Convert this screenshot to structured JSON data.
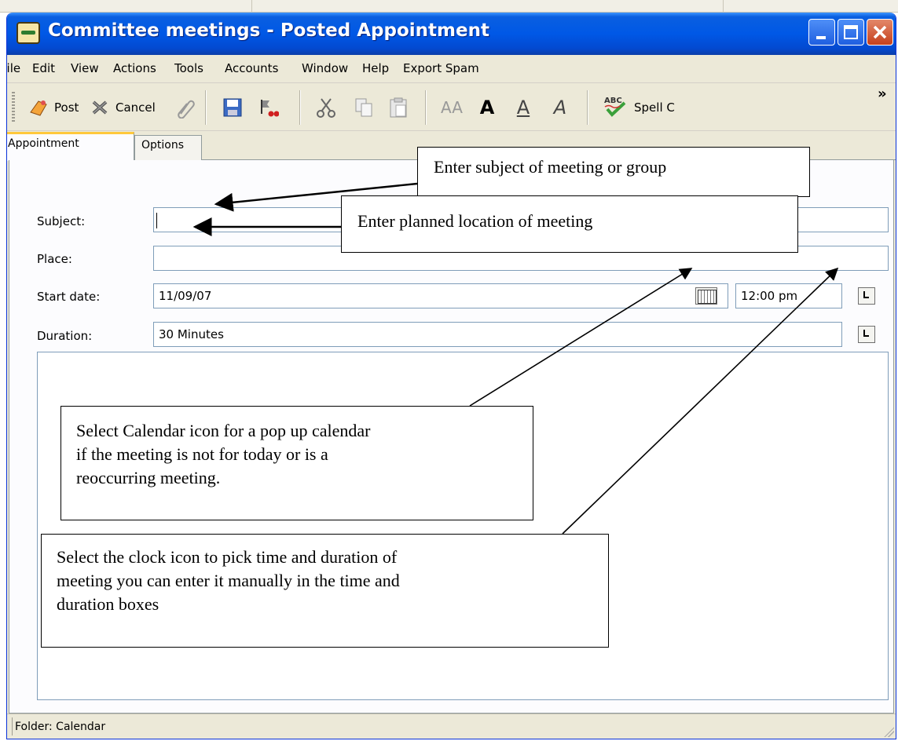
{
  "window": {
    "title": "Committee meetings - Posted Appointment"
  },
  "menu": [
    "File",
    "Edit",
    "View",
    "Actions",
    "Tools",
    "Accounts",
    "Window",
    "Help",
    "Export Spam"
  ],
  "toolbar": {
    "post_label": "Post",
    "cancel_label": "Cancel",
    "font_small": "AA",
    "font_bold": "A",
    "font_underline": "A",
    "font_italic": "A",
    "spell_badge": "ABC",
    "spell_label": "Spell C",
    "overflow": "»"
  },
  "tabs": [
    "Appointment",
    "Options"
  ],
  "form": {
    "subject_label": "Subject:",
    "subject_value": "",
    "place_label": "Place:",
    "place_value": "",
    "start_date_label": "Start date:",
    "start_date_value": "11/09/07",
    "start_time_value": "12:00 pm",
    "duration_label": "Duration:",
    "duration_value": "30 Minutes"
  },
  "status": {
    "text": "Folder: Calendar"
  },
  "callouts": {
    "subject": "Enter subject of meeting or group",
    "place": "Enter planned location of meeting",
    "calendar": [
      "Select Calendar icon for a pop up calendar",
      "if the meeting is not for today or is a",
      "reoccurring meeting."
    ],
    "clock": [
      "Select the clock icon to pick time and duration of",
      "meeting you can enter it manually in the time and",
      "duration boxes"
    ]
  },
  "icons": {
    "app": "appointment-icon",
    "post": "post-icon",
    "cancel": "cancel-icon",
    "attach": "paperclip-icon",
    "save": "save-icon",
    "flag": "flag-icon",
    "cut": "scissors-icon",
    "copy": "copy-icon",
    "paste": "paste-icon",
    "calendar": "calendar-icon",
    "clock": "clock-icon"
  },
  "colors": {
    "titlebar": "#0058e6",
    "window_bg": "#ece9d8",
    "active_tab_accent": "#ffc83c",
    "close_button": "#c5401d"
  }
}
